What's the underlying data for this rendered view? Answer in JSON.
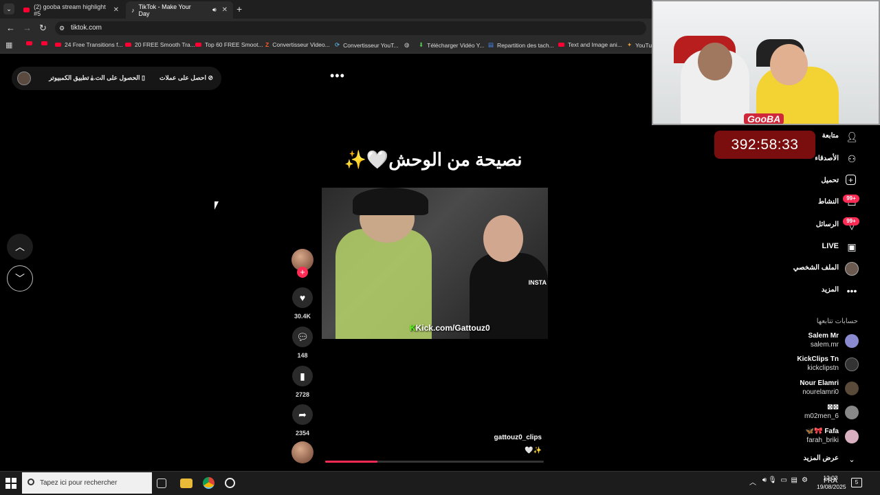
{
  "browser": {
    "tabs": [
      {
        "title": "(2) gooba stream highlight #5",
        "active": false
      },
      {
        "title": "TikTok - Make Your Day",
        "active": true
      }
    ],
    "url": "tiktok.com",
    "bookmarks": [
      "24 Free Transitions f...",
      "20 FREE Smooth Tra...",
      "Top 60 FREE Smoot...",
      "Convertisseur Video...",
      "Convertisseur YouT...",
      "Télécharger Vidéo Y...",
      "Repartition des tach...",
      "Text and Image ani...",
      "YouTube"
    ]
  },
  "tiktok": {
    "top_pill": {
      "get_coins": "احصل على عملات",
      "get_app": "الحصول على الت...",
      "desktop_app": "تطبيق الكمبيوتر"
    },
    "video": {
      "title": "نصيحة من الوحش🤍✨",
      "watermark_prefix": "K",
      "watermark": "Kick.com/Gattouz0",
      "insta": "INSTA",
      "author": "gattouz0_clips",
      "caption": "🤍✨",
      "progress": 0.24
    },
    "actions": {
      "likes": "30.4K",
      "comments": "148",
      "saves": "2728",
      "shares": "2354"
    },
    "sidebar": {
      "items": [
        {
          "label": "متابعة",
          "icon": "follow-icon"
        },
        {
          "label": "الأصدقاء",
          "icon": "friends-icon"
        },
        {
          "label": "تحميل",
          "icon": "upload-icon"
        },
        {
          "label": "النشاط",
          "icon": "activity-icon",
          "badge": "99+"
        },
        {
          "label": "الرسائل",
          "icon": "messages-icon",
          "badge": "99+"
        },
        {
          "label": "LIVE",
          "icon": "live-icon"
        },
        {
          "label": "الملف الشخصي",
          "icon": "profile-icon"
        },
        {
          "label": "المزيد",
          "icon": "more-icon"
        }
      ],
      "following_title": "حسابات تتابعها",
      "following": [
        {
          "name": "Salem Mr",
          "handle": "salem.mr"
        },
        {
          "name": "KickClips Tn",
          "handle": "kickclipstn"
        },
        {
          "name": "Nour Elamri",
          "handle": "nourelamri0"
        },
        {
          "name": "⊠⊠",
          "handle": "m02men_6"
        },
        {
          "name": "🦋🎀 Fafa",
          "handle": "farah_briki"
        }
      ],
      "see_more": "عرض المزيد"
    }
  },
  "stream": {
    "logo": "GooBA",
    "timer": "392:58:33"
  },
  "taskbar": {
    "search_placeholder": "Tapez ici pour rechercher",
    "lang": "FRA",
    "time": "12:03",
    "date": "19/08/2025",
    "notifications": "5"
  }
}
